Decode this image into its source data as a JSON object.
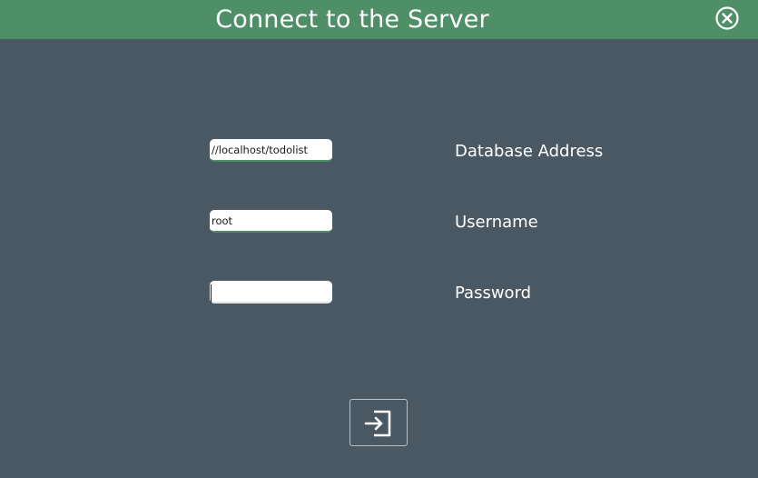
{
  "window": {
    "title": "Connect to the Server",
    "close_icon": "close-circle-icon"
  },
  "form": {
    "database_address": {
      "label": "Database Address",
      "value": "//localhost/todolist"
    },
    "username": {
      "label": "Username",
      "value": "root"
    },
    "password": {
      "label": "Password",
      "value": ""
    }
  },
  "actions": {
    "connect_icon": "login-enter-icon"
  },
  "colors": {
    "titlebar": "#4e8f68",
    "background": "#4a5863",
    "text": "#ffffff"
  }
}
